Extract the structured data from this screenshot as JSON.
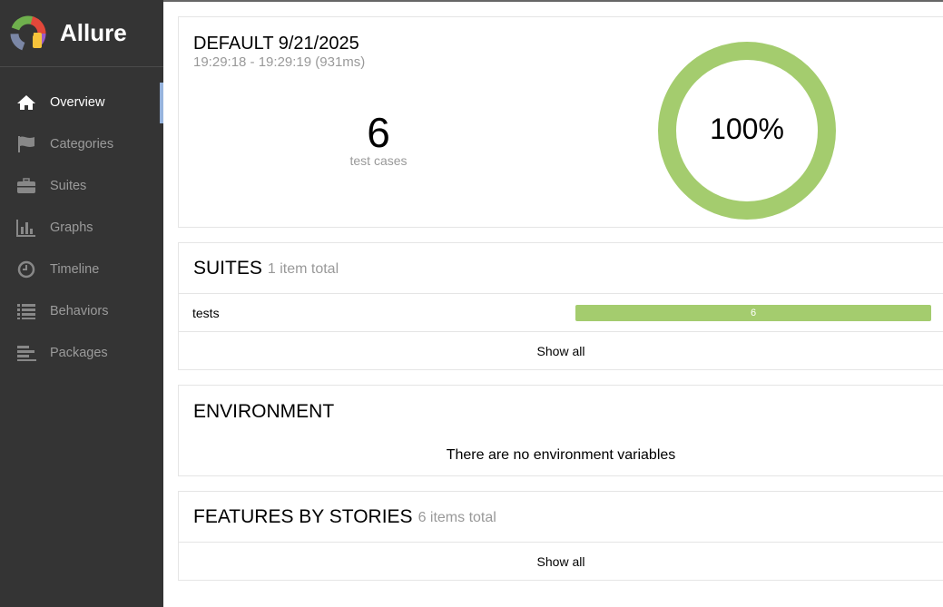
{
  "app": {
    "name": "Allure"
  },
  "nav": [
    {
      "label": "Overview",
      "icon": "home-icon",
      "active": true
    },
    {
      "label": "Categories",
      "icon": "flag-icon",
      "active": false
    },
    {
      "label": "Suites",
      "icon": "briefcase-icon",
      "active": false
    },
    {
      "label": "Graphs",
      "icon": "bar-chart-icon",
      "active": false
    },
    {
      "label": "Timeline",
      "icon": "clock-icon",
      "active": false
    },
    {
      "label": "Behaviors",
      "icon": "list-icon",
      "active": false
    },
    {
      "label": "Packages",
      "icon": "align-left-icon",
      "active": false
    }
  ],
  "summary": {
    "title": "DEFAULT 9/21/2025",
    "time": "19:29:18 - 19:29:19 (931ms)",
    "count": "6",
    "count_label": "test cases",
    "percent": "100%",
    "pass_fraction": 1.0,
    "pass_color": "#a4cc6e"
  },
  "suites": {
    "title": "SUITES",
    "total": "1 item total",
    "rows": [
      {
        "name": "tests",
        "value": "6"
      }
    ],
    "show_all": "Show all"
  },
  "environment": {
    "title": "ENVIRONMENT",
    "message": "There are no environment variables"
  },
  "features": {
    "title": "FEATURES BY STORIES",
    "total": "6 items total",
    "show_all": "Show all"
  }
}
